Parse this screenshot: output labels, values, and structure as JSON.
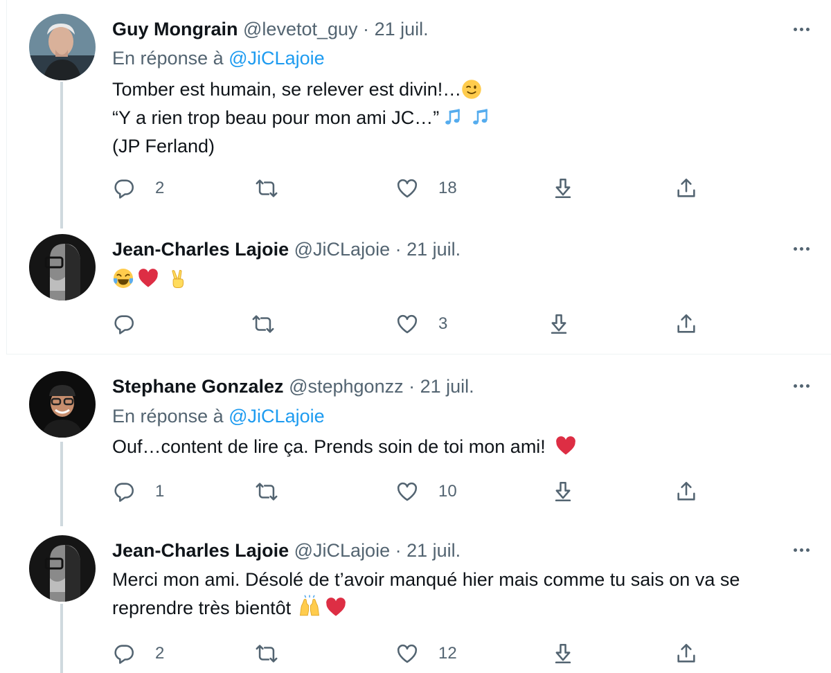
{
  "tweets": [
    {
      "name": "Guy Mongrain",
      "handle": "@levetot_guy",
      "separator": "·",
      "date": "21 juil.",
      "reply_prefix": "En réponse à",
      "reply_to": "@JiCLajoie",
      "lines": [
        "Tomber est humain, se relever est divin!…",
        "“Y a rien trop beau pour mon ami JC…”",
        "(JP Ferland)"
      ],
      "emojis": [
        "winking-face",
        "musical-notes",
        "musical-notes"
      ],
      "replies": "2",
      "retweets": "",
      "likes": "18"
    },
    {
      "name": "Jean-Charles Lajoie",
      "handle": "@JiCLajoie",
      "separator": "·",
      "date": "21 juil.",
      "emojis": [
        "tears-of-joy",
        "red-heart",
        "victory-hand"
      ],
      "replies": "",
      "retweets": "",
      "likes": "3"
    },
    {
      "name": "Stephane Gonzalez",
      "handle": "@stephgonzz",
      "separator": "·",
      "date": "21 juil.",
      "reply_prefix": "En réponse à",
      "reply_to": "@JiCLajoie",
      "lines": [
        "Ouf…content de lire ça. Prends soin de toi mon ami!"
      ],
      "emojis": [
        "red-heart"
      ],
      "replies": "1",
      "retweets": "",
      "likes": "10"
    },
    {
      "name": "Jean-Charles Lajoie",
      "handle": "@JiCLajoie",
      "separator": "·",
      "date": "21 juil.",
      "lines": [
        "Merci mon ami. Désolé de t’avoir manqué hier mais comme tu sais on va se",
        "reprendre très bientôt"
      ],
      "emojis": [
        "raising-hands",
        "red-heart"
      ],
      "replies": "2",
      "retweets": "",
      "likes": "12"
    }
  ],
  "colors": {
    "accent": "#1d9bf0",
    "secondary_text": "#536471",
    "thread_line": "#cfd9de"
  },
  "icons": [
    "reply-icon",
    "retweet-icon",
    "like-icon",
    "download-icon",
    "share-icon",
    "more-icon"
  ]
}
